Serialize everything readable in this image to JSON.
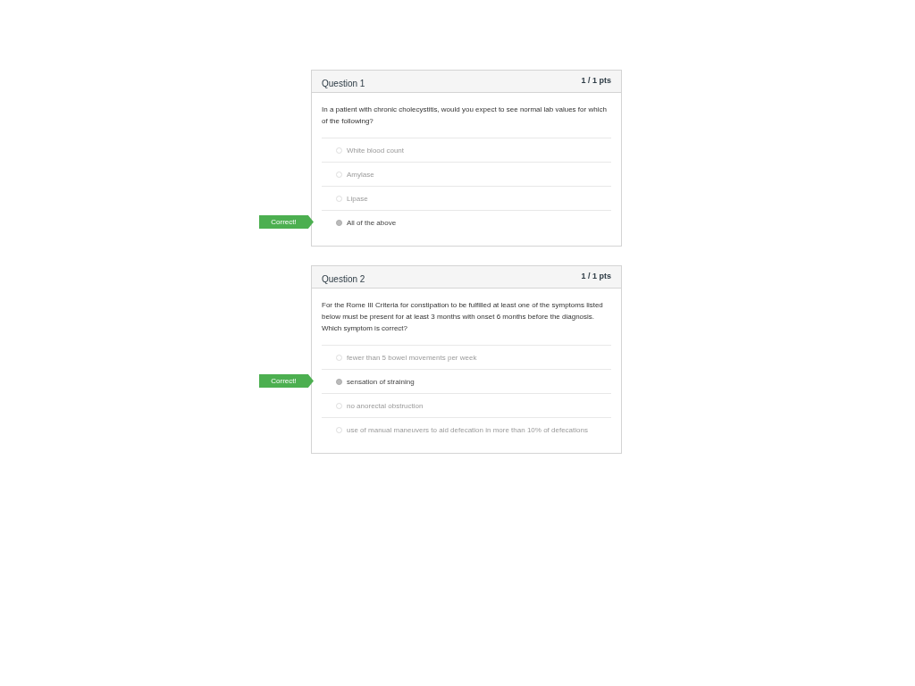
{
  "questions": [
    {
      "title": "Question 1",
      "points": "1 / 1 pts",
      "text": "In a patient with chronic cholecystitis, would you expect to see normal lab values for which of the following?",
      "answers": [
        {
          "text": "White blood count",
          "selected": false
        },
        {
          "text": "Amylase",
          "selected": false
        },
        {
          "text": "Lipase",
          "selected": false
        },
        {
          "text": "All of the above",
          "selected": true,
          "banner": "Correct!"
        }
      ]
    },
    {
      "title": "Question 2",
      "points": "1 / 1 pts",
      "text": "For the Rome III Criteria for constipation to be fulfilled at least one of the symptoms listed below must be present for at least 3 months with onset 6 months before the diagnosis.  Which symptom is correct?",
      "answers": [
        {
          "text": "fewer than 5 bowel movements per week",
          "selected": false
        },
        {
          "text": "sensation of straining",
          "selected": true,
          "banner": "Correct!"
        },
        {
          "text": "no anorectal obstruction",
          "selected": false
        },
        {
          "text": "use of manual maneuvers to aid defecation in more than 10% of defecations",
          "selected": false
        }
      ]
    }
  ]
}
